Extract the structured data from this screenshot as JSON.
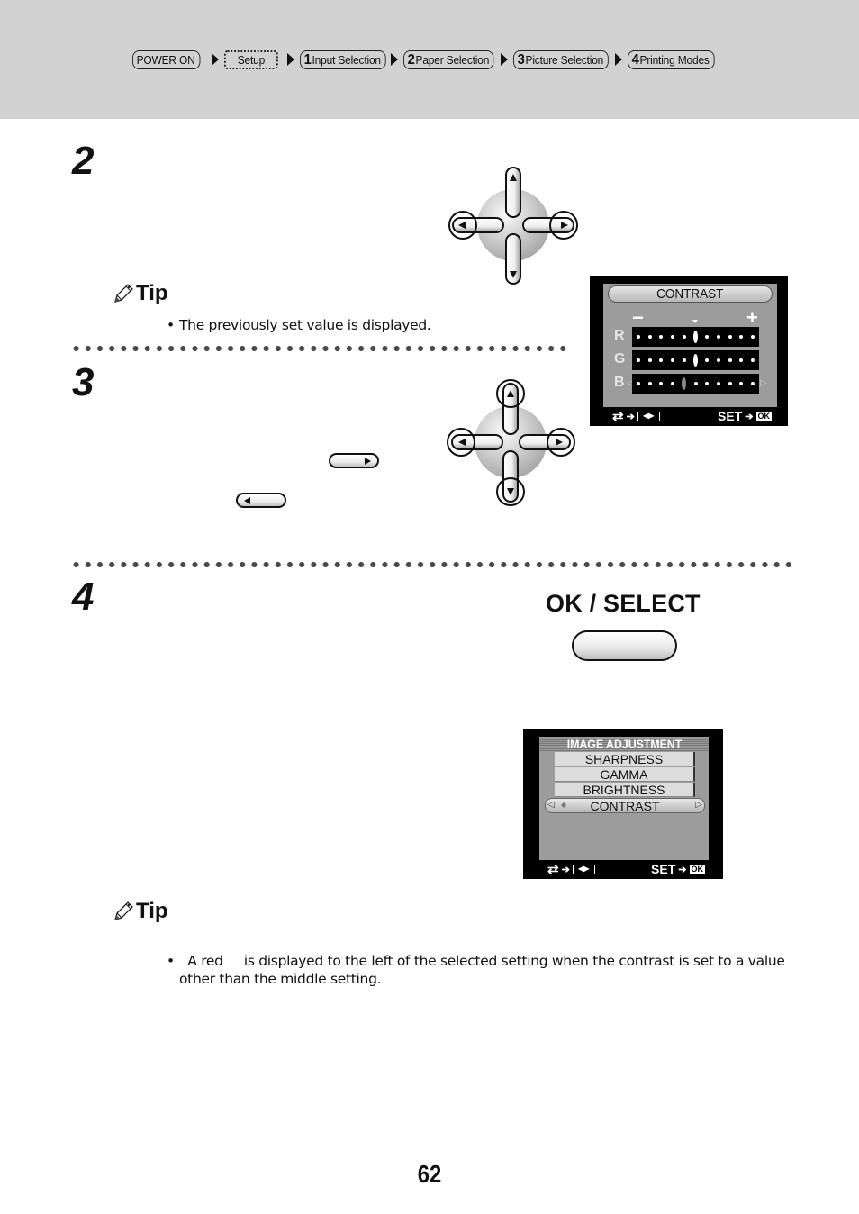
{
  "breadcrumb": {
    "items": [
      {
        "number": "",
        "label": "POWER ON",
        "current": false
      },
      {
        "number": "",
        "label": "Setup",
        "current": true
      },
      {
        "number": "1",
        "label": "Input Selection",
        "current": false
      },
      {
        "number": "2",
        "label": "Paper Selection",
        "current": false
      },
      {
        "number": "3",
        "label": "Picture Selection",
        "current": false
      },
      {
        "number": "4",
        "label": "Printing Modes",
        "current": false
      }
    ]
  },
  "steps": [
    {
      "number": "2"
    },
    {
      "number": "3"
    },
    {
      "number": "4"
    }
  ],
  "tips": [
    {
      "title": "Tip",
      "text": "The previously set value is displayed."
    },
    {
      "title": "Tip",
      "text": "A red     is displayed to the left of the selected setting when the contrast is set to a value other than the middle setting."
    }
  ],
  "contrast_screen": {
    "title": "CONTRAST",
    "minus_label": "−",
    "plus_label": "+",
    "positions": 11,
    "channels": [
      {
        "label": "R",
        "value_position": 6,
        "selected": false
      },
      {
        "label": "G",
        "value_position": 6,
        "selected": false
      },
      {
        "label": "B",
        "value_position": 5,
        "selected": true
      }
    ],
    "footer_left": "⇄ ➔ ◂▸",
    "footer_set": "SET",
    "footer_ok": "OK"
  },
  "image_adjustment_screen": {
    "title": "IMAGE ADJUSTMENT",
    "items": [
      {
        "label": "SHARPNESS",
        "selected": false
      },
      {
        "label": "GAMMA",
        "selected": false
      },
      {
        "label": "BRIGHTNESS",
        "selected": false
      },
      {
        "label": "CONTRAST",
        "selected": true
      }
    ],
    "footer_set": "SET",
    "footer_ok": "OK"
  },
  "ok_select": {
    "label": "OK / SELECT"
  },
  "page_number": "62"
}
